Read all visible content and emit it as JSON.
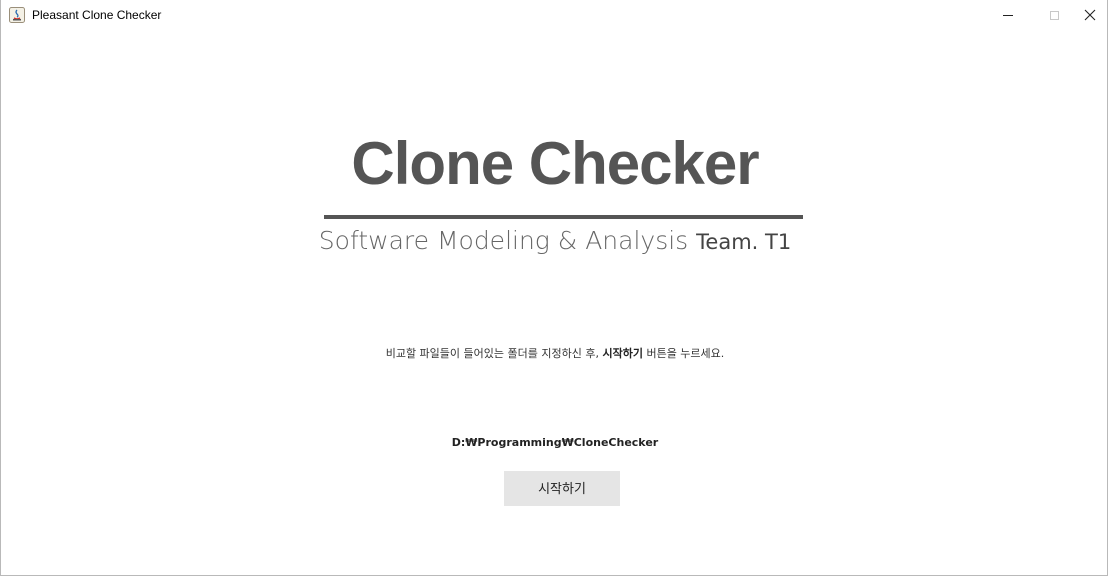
{
  "window": {
    "title": "Pleasant Clone Checker",
    "controls": {
      "minimize_label": "–",
      "maximize_label": "□",
      "close_label": "✕"
    }
  },
  "logo": {
    "title": "Clone Checker",
    "subtitle_main": "Software Modeling & Analysis",
    "subtitle_team": "Team. T1",
    "color": "#555555"
  },
  "instruction": {
    "before": "비교할 파일들이 들어있는 폴더를 지정하신 후, ",
    "emphasis": "시작하기",
    "after": " 버튼을 누르세요."
  },
  "folder_path": "D:₩Programming₩CloneChecker",
  "start_button": {
    "label": "시작하기",
    "background": "#e5e5e5"
  }
}
